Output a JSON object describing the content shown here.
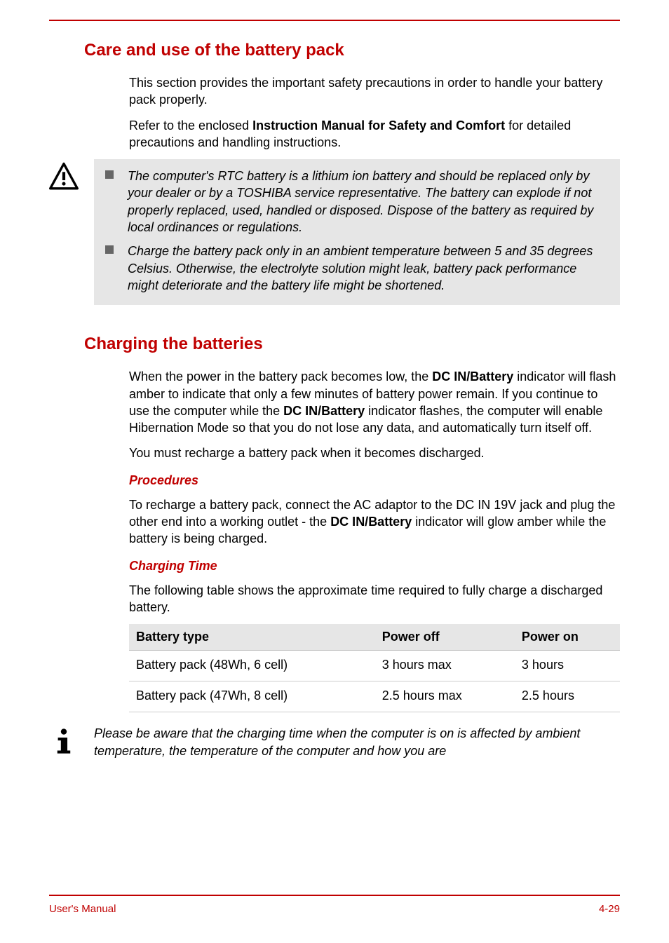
{
  "section1": {
    "heading": "Care and use of the battery pack",
    "p1a": "This section provides the important safety precautions in order to handle your battery pack properly.",
    "p2a": "Refer to the enclosed ",
    "p2b": "Instruction Manual for Safety and Comfort",
    "p2c": " for detailed precautions and handling instructions.",
    "warn1": "The computer's RTC battery is a lithium ion battery and should be replaced only by your dealer or by a TOSHIBA service representative. The battery can explode if not properly replaced, used, handled or disposed. Dispose of the battery as required by local ordinances or regulations.",
    "warn2": "Charge the battery pack only in an ambient temperature between 5 and 35 degrees Celsius. Otherwise, the electrolyte solution might leak, battery pack performance might deteriorate and the battery life might be shortened."
  },
  "section2": {
    "heading": "Charging the batteries",
    "p1a": "When the power in the battery pack becomes low, the ",
    "p1b": "DC IN/Battery",
    "p1c": " indicator will flash amber to indicate that only a few minutes of battery power remain. If you continue to use the computer while the ",
    "p1d": "DC IN/Battery",
    "p1e": " indicator flashes, the computer will enable Hibernation Mode so that you do not lose any data, and automatically turn itself off.",
    "p2": "You must recharge a battery pack when it becomes discharged.",
    "h3a": "Procedures",
    "p3a": "To recharge a battery pack, connect the AC adaptor to the DC IN 19V jack and plug the other end into a working outlet - the ",
    "p3b": "DC IN/Battery",
    "p3c": " indicator will glow amber while the battery is being charged.",
    "h3b": "Charging Time",
    "p4": "The following table shows the approximate time required to fully charge a discharged battery.",
    "table": {
      "headers": [
        "Battery type",
        "Power off",
        "Power on"
      ],
      "rows": [
        [
          "Battery pack (48Wh, 6 cell)",
          "3 hours max",
          "3 hours"
        ],
        [
          "Battery pack (47Wh, 8 cell)",
          "2.5 hours max",
          "2.5 hours"
        ]
      ]
    },
    "info": "Please be aware that the charging time when the computer is on is affected by ambient temperature, the temperature of the computer and how you are"
  },
  "footer": {
    "left": "User's Manual",
    "right": "4-29"
  },
  "icons": {
    "warning": "warning-icon",
    "info": "info-icon"
  }
}
